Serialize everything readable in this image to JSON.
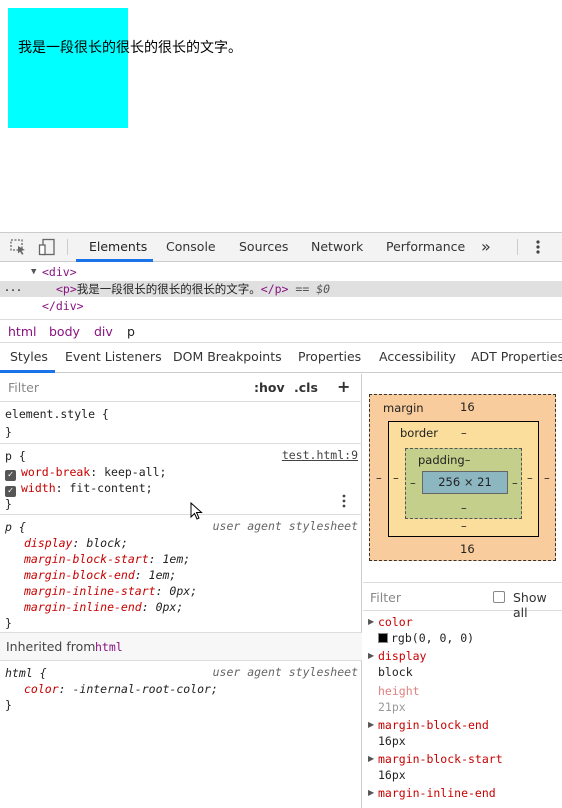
{
  "page": {
    "text": "我是一段很长的很长的很长的文字。"
  },
  "toolbar": {
    "tabs": [
      "Elements",
      "Console",
      "Sources",
      "Network",
      "Performance"
    ],
    "more": "»"
  },
  "dom": {
    "div_open": "<div>",
    "p_open": "<p>",
    "p_text": "我是一段很长的很长的很长的文字。",
    "p_close": "</p>",
    "selected_marker": "== $0",
    "div_close": "</div>",
    "dots": "..."
  },
  "breadcrumb": [
    "html",
    "body",
    "div",
    "p"
  ],
  "subtabs": [
    "Styles",
    "Event Listeners",
    "DOM Breakpoints",
    "Properties",
    "Accessibility",
    "ADT Properties"
  ],
  "styles": {
    "filter_placeholder": "Filter",
    "hov": ":hov",
    "cls": ".cls",
    "plus": "+",
    "element_style": "element.style {",
    "close_brace": "}",
    "rule1": {
      "selector": "p {",
      "origin": "test.html:9",
      "props": [
        {
          "name": "word-break",
          "value": "keep-all;"
        },
        {
          "name": "width",
          "value": "fit-content;"
        }
      ]
    },
    "rule2": {
      "selector": "p {",
      "origin": "user agent stylesheet",
      "props": [
        {
          "name": "display",
          "value": "block;"
        },
        {
          "name": "margin-block-start",
          "value": "1em;"
        },
        {
          "name": "margin-block-end",
          "value": "1em;"
        },
        {
          "name": "margin-inline-start",
          "value": "0px;"
        },
        {
          "name": "margin-inline-end",
          "value": "0px;"
        }
      ]
    },
    "inherited_label": "Inherited from",
    "inherited_tag": "html",
    "rule3": {
      "selector": "html {",
      "origin": "user agent stylesheet",
      "props": [
        {
          "name": "color",
          "value": "-internal-root-color;"
        }
      ]
    }
  },
  "boxmodel": {
    "margin_label": "margin",
    "margin_top": "16",
    "margin_bottom": "16",
    "margin_left": "–",
    "margin_right": "–",
    "border_label": "border",
    "border_top": "–",
    "border_bottom": "–",
    "border_left": "–",
    "border_right": "–",
    "padding_label": "padding–",
    "padding_bottom": "–",
    "padding_left": "–",
    "padding_right": "–",
    "content": "256 × 21"
  },
  "computed": {
    "filter_placeholder": "Filter",
    "show_all": "Show all",
    "items": [
      {
        "name": "color",
        "value": "rgb(0, 0, 0)"
      },
      {
        "name": "display",
        "value": "block"
      },
      {
        "name": "height",
        "value": "21px"
      },
      {
        "name": "margin-block-end",
        "value": "16px"
      },
      {
        "name": "margin-block-start",
        "value": "16px"
      },
      {
        "name": "margin-inline-end",
        "value": ""
      }
    ]
  },
  "colors": {
    "accent": "#1a73e8",
    "tag": "#881280",
    "prop": "#c80000",
    "cyan": "#00ffff"
  }
}
